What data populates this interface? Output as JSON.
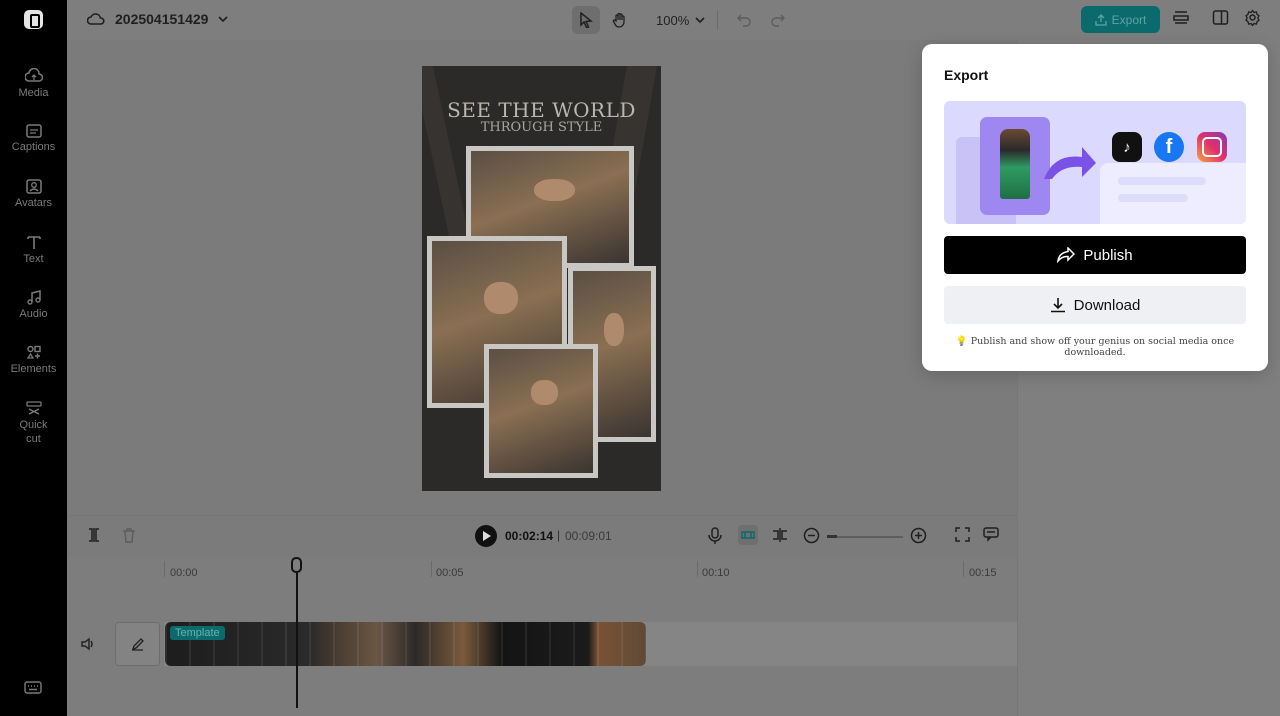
{
  "project": {
    "name": "202504151429"
  },
  "toolbar": {
    "zoom": "100%",
    "export_label": "Export"
  },
  "sidebar": {
    "items": [
      {
        "label": "Media"
      },
      {
        "label": "Captions"
      },
      {
        "label": "Avatars"
      },
      {
        "label": "Text"
      },
      {
        "label": "Audio"
      },
      {
        "label": "Elements"
      },
      {
        "label": "Quick"
      },
      {
        "label": "cut"
      }
    ]
  },
  "canvas": {
    "title_line1": "SEE THE WORLD",
    "title_line2": "THROUGH STYLE"
  },
  "playback": {
    "current": "00:02:14",
    "separator": "|",
    "total": "00:09:01"
  },
  "timeline": {
    "ruler": [
      "00:00",
      "00:05",
      "00:10",
      "00:15"
    ],
    "clip_tag": "Template"
  },
  "export_popup": {
    "title": "Export",
    "publish_label": "Publish",
    "download_label": "Download",
    "hint": "💡 Publish and show off your genius on social media once downloaded.",
    "social": [
      "tiktok-icon",
      "facebook-icon",
      "instagram-icon"
    ]
  },
  "colors": {
    "accent": "#0b6a6c",
    "publish_bg": "#000000",
    "banner_bg": "#dcd9ff"
  }
}
